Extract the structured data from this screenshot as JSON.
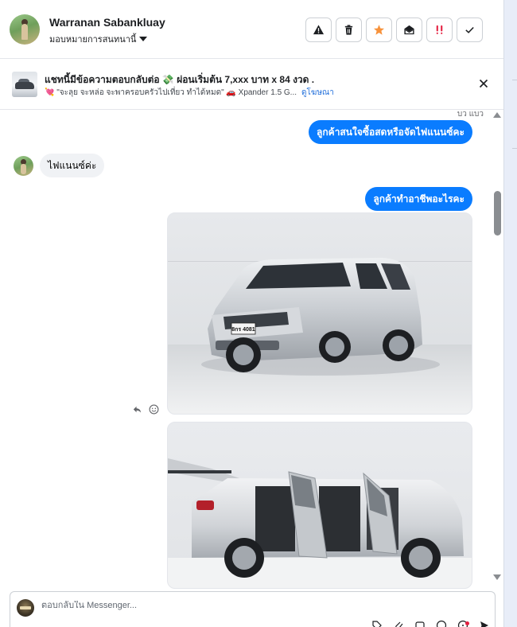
{
  "header": {
    "name": "Warranan Sabankluay",
    "assign_label": "มอบหมายการสนทนานี้",
    "actions": [
      {
        "name": "report-spam",
        "icon": "warning-icon"
      },
      {
        "name": "delete",
        "icon": "trash-icon"
      },
      {
        "name": "follow-up",
        "icon": "star-icon",
        "color": "#f7923b"
      },
      {
        "name": "mark-unread",
        "icon": "envelope-open-icon"
      },
      {
        "name": "important",
        "icon": "double-exclamation-icon",
        "color": "#e41e3f"
      },
      {
        "name": "mark-done",
        "icon": "check-icon"
      }
    ]
  },
  "ad": {
    "title": "แชทนี้มีข้อความตอบกลับต่อ 💸 ผ่อนเริ่มต้น 7,xxx บาท x 84 งวด .",
    "subtitle": "💘 \"จะลุย จะหล่อ จะพาครอบครัวไปเที่ยว ทำได้หมด\" 🚗 Xpander 1.5 G...",
    "link": "ดูโฆษณา"
  },
  "messages": {
    "seen_label": "บว แบว",
    "outgoing_1": "ลูกค้าสนใจซื้อสดหรือจัดไฟแนนซ์คะ",
    "incoming_1": "ไฟแนนซ์ค่ะ",
    "outgoing_2": "ลูกค้าทำอาชีพอะไรคะ",
    "photo_1_plate": "8กร 4081"
  },
  "composer": {
    "placeholder": "ตอบกลับใน Messenger..."
  },
  "colors": {
    "accent": "#0a7cff",
    "incoming_bg": "#f0f2f5",
    "rail": "#e8edf8"
  }
}
